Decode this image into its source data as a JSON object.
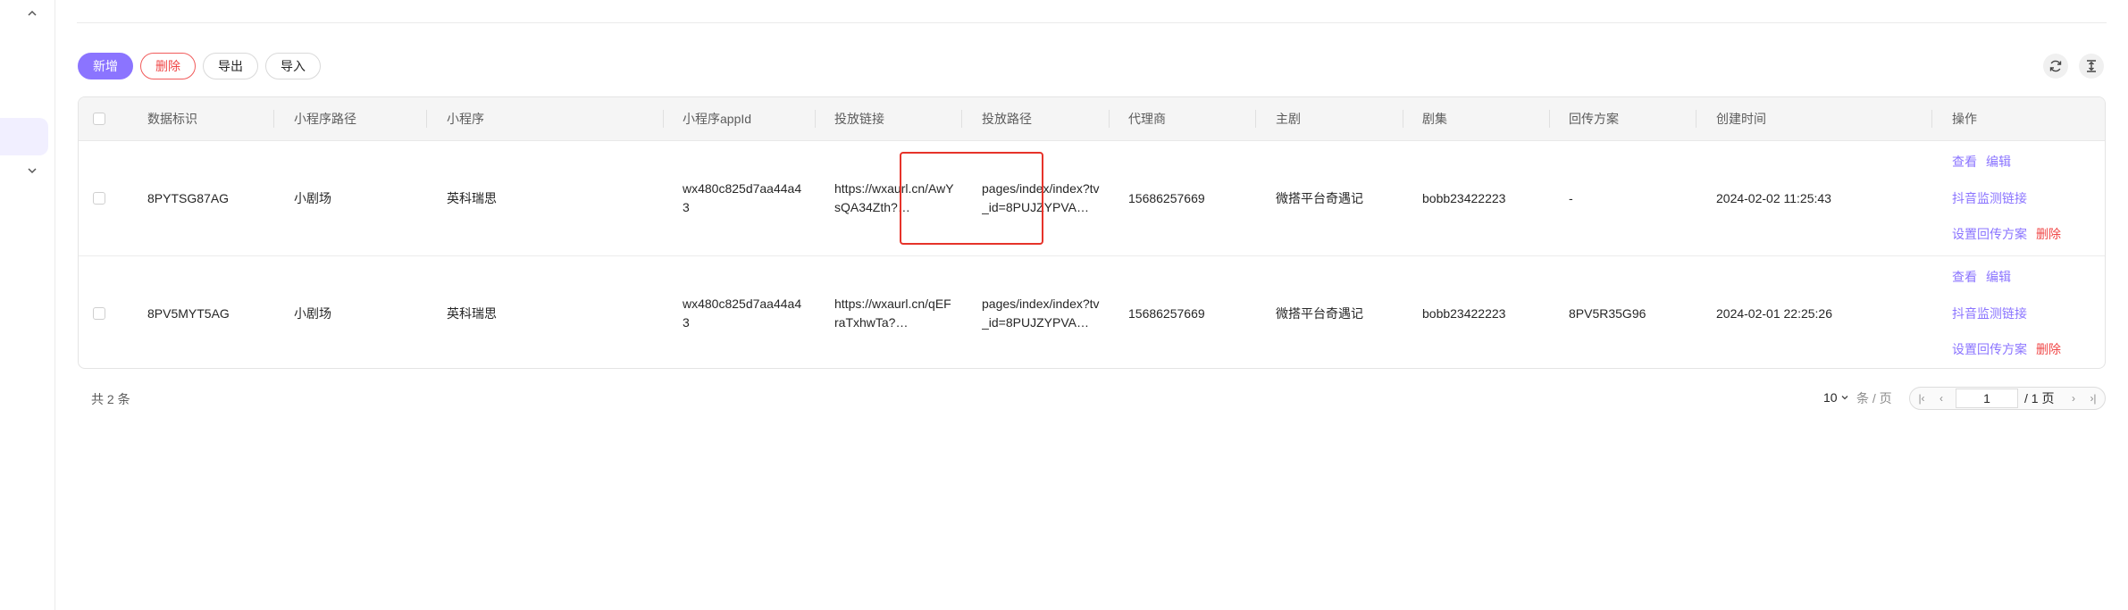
{
  "toolbar": {
    "add_label": "新增",
    "delete_label": "删除",
    "export_label": "导出",
    "import_label": "导入"
  },
  "table": {
    "columns": [
      "数据标识",
      "小程序路径",
      "小程序",
      "小程序appId",
      "投放链接",
      "投放路径",
      "代理商",
      "主剧",
      "剧集",
      "回传方案",
      "创建时间",
      "操作"
    ],
    "rows": [
      {
        "id": "8PYTSG87AG",
        "path_type": "小剧场",
        "app": "英科瑞思",
        "appid": "wx480c825d7aa44a43",
        "link": "https://wxaurl.cn/AwYsQA34Zth?…",
        "route": "pages/index/index?tv_id=8PUJZYPVA…",
        "agent": "15686257669",
        "drama": "微搭平台奇遇记",
        "episode": "bobb23422223",
        "callback": "-",
        "created": "2024-02-02 11:25:43"
      },
      {
        "id": "8PV5MYT5AG",
        "path_type": "小剧场",
        "app": "英科瑞思",
        "appid": "wx480c825d7aa44a43",
        "link": "https://wxaurl.cn/qEFraTxhwTa?…",
        "route": "pages/index/index?tv_id=8PUJZYPVA…",
        "agent": "15686257669",
        "drama": "微搭平台奇遇记",
        "episode": "bobb23422223",
        "callback": "8PV5R35G96",
        "created": "2024-02-01 22:25:26"
      }
    ],
    "actions": {
      "view": "查看",
      "edit": "编辑",
      "douyin": "抖音监测链接",
      "set_callback": "设置回传方案",
      "delete": "删除"
    }
  },
  "footer": {
    "total": "共 2 条",
    "page_size": "10",
    "per_page": "条 / 页",
    "current_page": "1",
    "total_pages": "/ 1 页"
  },
  "colors": {
    "primary": "#8b74ff",
    "danger": "#f04848",
    "highlight": "#e6332a"
  }
}
